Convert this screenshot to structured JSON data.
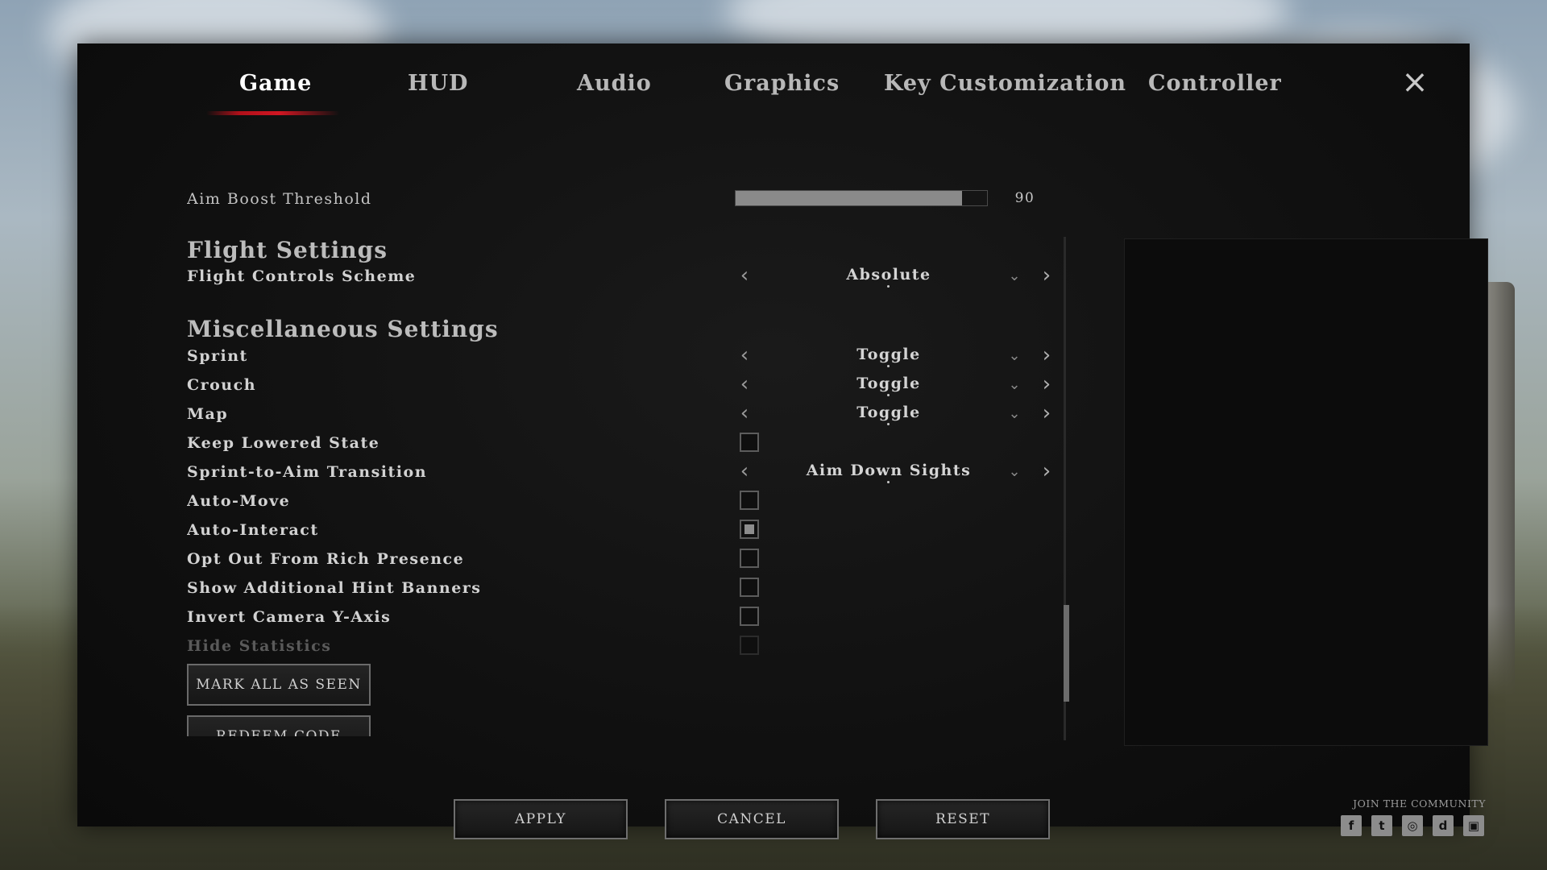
{
  "tabs": [
    {
      "label": "Game",
      "active": true
    },
    {
      "label": "HUD"
    },
    {
      "label": "Audio"
    },
    {
      "label": "Graphics"
    },
    {
      "label": "Key Customization"
    },
    {
      "label": "Controller"
    }
  ],
  "close_icon": "×",
  "settings": {
    "aim_boost": {
      "label": "Aim Boost Threshold",
      "value": "90",
      "fill_fraction": 0.9
    },
    "flight_section": "Flight Settings",
    "flight_scheme": {
      "label": "Flight Controls Scheme",
      "value": "Absolute"
    },
    "misc_section": "Miscellaneous Settings",
    "sprint": {
      "label": "Sprint",
      "value": "Toggle"
    },
    "crouch": {
      "label": "Crouch",
      "value": "Toggle"
    },
    "map": {
      "label": "Map",
      "value": "Toggle"
    },
    "keep_lowered": {
      "label": "Keep Lowered State",
      "checked": false
    },
    "sprint_to_aim": {
      "label": "Sprint-to-Aim Transition",
      "value": "Aim Down Sights"
    },
    "auto_move": {
      "label": "Auto-Move",
      "checked": false
    },
    "auto_interact": {
      "label": "Auto-Interact",
      "checked": true
    },
    "opt_out_rich": {
      "label": "Opt Out From Rich Presence",
      "checked": false
    },
    "hint_banners": {
      "label": "Show Additional Hint Banners",
      "checked": false
    },
    "invert_camera": {
      "label": "Invert Camera Y-Axis",
      "checked": false
    },
    "hide_statistics": {
      "label": "Hide Statistics",
      "checked": false
    }
  },
  "buttons": {
    "mark_all": "MARK ALL AS SEEN",
    "redeem": "REDEEM CODE",
    "apply": "APPLY",
    "cancel": "CANCEL",
    "reset": "RESET"
  },
  "community": {
    "label": "JOIN THE COMMUNITY",
    "icons": [
      "facebook-icon",
      "twitter-icon",
      "instagram-icon",
      "discord-icon",
      "twitch-icon"
    ],
    "glyphs": [
      "f",
      "t",
      "◎",
      "d",
      "▣"
    ]
  },
  "arrows": {
    "left": "‹",
    "right": "›",
    "chevron": "⌄"
  }
}
